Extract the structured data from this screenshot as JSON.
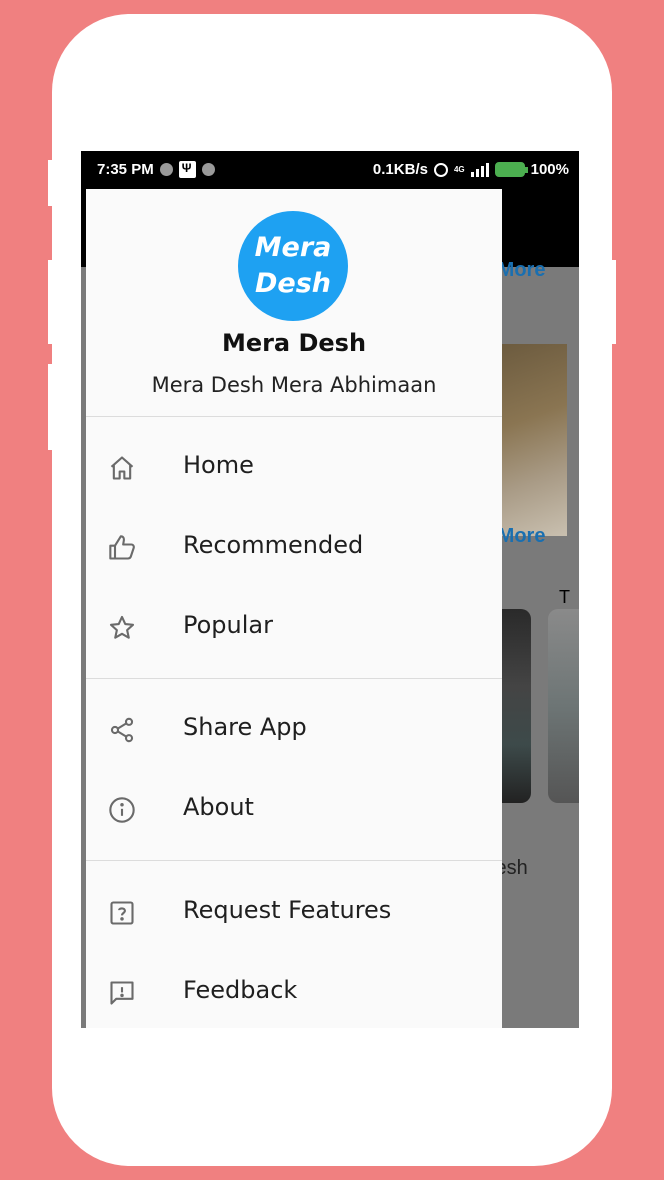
{
  "status_bar": {
    "time": "7:35 PM",
    "speed": "0.1KB/s",
    "network": "4G",
    "battery": "100%"
  },
  "background": {
    "see_more_1": "e More",
    "see_more_2": "e More",
    "card_letter": "T",
    "text_fragment": "lesh"
  },
  "drawer": {
    "app_logo_line1": "Mera",
    "app_logo_line2": "Desh",
    "app_name": "Mera Desh",
    "tagline": "Mera Desh Mera Abhimaan",
    "items": [
      {
        "label": "Home",
        "icon": "home-icon"
      },
      {
        "label": "Recommended",
        "icon": "thumbs-up-icon"
      },
      {
        "label": "Popular",
        "icon": "star-icon"
      },
      {
        "label": "Share App",
        "icon": "share-icon"
      },
      {
        "label": "About",
        "icon": "info-icon"
      },
      {
        "label": "Request Features",
        "icon": "help-box-icon"
      },
      {
        "label": "Feedback",
        "icon": "feedback-icon"
      }
    ]
  },
  "colors": {
    "page_background": "#f08080",
    "logo_blue": "#1ea1f2",
    "link_blue": "#1a6fb0",
    "drawer_background": "#fafafa"
  }
}
